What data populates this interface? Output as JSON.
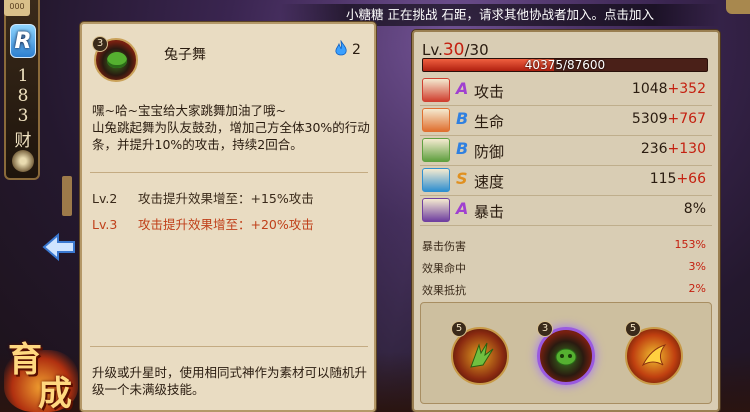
{
  "colors": {
    "accent_red": "#c42010",
    "panel_bg": "#e9dcc2",
    "stats_bg": "#d9cdb4",
    "rarity_blue": "#2c7fd0"
  },
  "notification": {
    "text": "小糖糖 正在挑战 石距，请求其他协战者加入。点击加入"
  },
  "rail": {
    "rarity": "R",
    "digits": [
      "1",
      "8",
      "3"
    ],
    "last_char": "财",
    "top_label": "000"
  },
  "develop_badge": {
    "char1": "育",
    "char2": "成"
  },
  "skill": {
    "name": "兔子舞",
    "icon_level": "3",
    "fire_cost": "2",
    "description": "嘿~哈~宝宝给大家跳舞加油了哦~\n山兔跳起舞为队友鼓劲，增加己方全体30%的行动条，并提升10%的攻击，持续2回合。",
    "upgrades": [
      {
        "level": "Lv.2",
        "text": "攻击提升效果增至：+15%攻击"
      },
      {
        "level": "Lv.3",
        "text": "攻击提升效果增至：+20%攻击"
      }
    ],
    "footer": "升级或升星时，使用相同式神作为素材可以随机升级一个未满级技能。"
  },
  "stats": {
    "level_label": "Lv.",
    "level_current": "30",
    "level_max": "/30",
    "xp_text": "40375/87600",
    "xp_fraction": 0.461,
    "rows": [
      {
        "grade": "A",
        "name": "攻击",
        "base": "1048",
        "bonus": "+352",
        "icon": "attack-icon",
        "icon_color": "#d04030",
        "grade_color": "#a040d0"
      },
      {
        "grade": "B",
        "name": "生命",
        "base": "5309",
        "bonus": "+767",
        "icon": "health-icon",
        "icon_color": "#e07030",
        "grade_color": "#3080e0"
      },
      {
        "grade": "B",
        "name": "防御",
        "base": "236",
        "bonus": "+130",
        "icon": "defense-icon",
        "icon_color": "#60a040",
        "grade_color": "#3080e0"
      },
      {
        "grade": "S",
        "name": "速度",
        "base": "115",
        "bonus": "+66",
        "icon": "speed-icon",
        "icon_color": "#3090d0",
        "grade_color": "#e09020"
      },
      {
        "grade": "A",
        "name": "暴击",
        "base": "8%",
        "bonus": "",
        "icon": "critical-icon",
        "icon_color": "#7040a0",
        "grade_color": "#a040d0"
      }
    ],
    "sub_rows": [
      {
        "name": "暴击伤害",
        "value": "153%"
      },
      {
        "name": "效果命中",
        "value": "3%"
      },
      {
        "name": "效果抵抗",
        "value": "2%"
      }
    ],
    "souls": [
      {
        "level": "5",
        "selected": false,
        "icon": "soul-green-claw-icon"
      },
      {
        "level": "3",
        "selected": true,
        "icon": "soul-dance-mask-icon"
      },
      {
        "level": "5",
        "selected": false,
        "icon": "soul-fire-strike-icon"
      }
    ]
  }
}
